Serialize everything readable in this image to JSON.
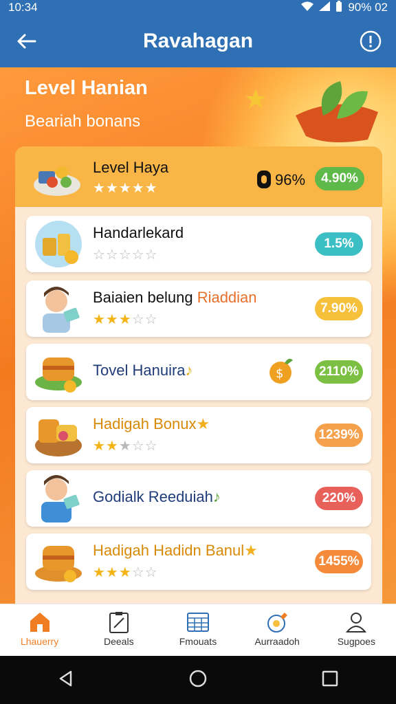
{
  "status_bar": {
    "time": "10:34",
    "battery": "90% 02"
  },
  "app_bar": {
    "title": "Ravahagan"
  },
  "hero": {
    "title": "Level Hanian",
    "subtitle": "Beariah bonans"
  },
  "featured": {
    "title": "Level Haya",
    "stars": "★★★★★",
    "badge_text": "96%",
    "pill": "4.90%",
    "pill_color": "#5fb84a"
  },
  "items": [
    {
      "title": "Handarlekard",
      "title_accent": "",
      "stars_on": "",
      "stars_off": "☆☆☆☆☆",
      "pill": "1.5%",
      "pill_color": "#3cbfc4",
      "title_color": "#111111"
    },
    {
      "title": "Baiaien belung ",
      "title_accent": "Riaddian",
      "stars_on": "★★★",
      "stars_off": "☆☆",
      "pill": "7.90%",
      "pill_color": "#f6c03a",
      "title_color": "#111111"
    },
    {
      "title": "Tovel Hanuira",
      "title_accent": "♪",
      "stars_on": "",
      "stars_off": "",
      "pill": "2110%",
      "pill_color": "#7bc043",
      "title_color": "#1f3c78"
    },
    {
      "title": "Hadigah Bonux",
      "title_accent": "★",
      "stars_on": "★★",
      "stars_off": "★☆☆",
      "pill": "1239%",
      "pill_color": "#f5a04a",
      "title_color": "#d88a08"
    },
    {
      "title": "Godialk Reeduiah",
      "title_accent": "♪",
      "stars_on": "",
      "stars_off": "",
      "pill": "220%",
      "pill_color": "#e8605a",
      "title_color": "#1f3c78"
    },
    {
      "title": "Hadigah Hadidn Banul",
      "title_accent": "★",
      "stars_on": "★★★",
      "stars_off": "☆☆",
      "pill": "1455%",
      "pill_color": "#f48a3a",
      "title_color": "#d88a08"
    }
  ],
  "bottom_nav": [
    {
      "label": "Lhauerry",
      "icon": "home-icon",
      "active": true
    },
    {
      "label": "Deeals",
      "icon": "clipboard-icon",
      "active": false
    },
    {
      "label": "Fmouats",
      "icon": "grid-icon",
      "active": false
    },
    {
      "label": "Aurraadoh",
      "icon": "medal-icon",
      "active": false
    },
    {
      "label": "Sugpoes",
      "icon": "user-icon",
      "active": false
    }
  ],
  "colors": {
    "app_bar": "#2f6fb3",
    "accent_orange": "#f07d22"
  }
}
